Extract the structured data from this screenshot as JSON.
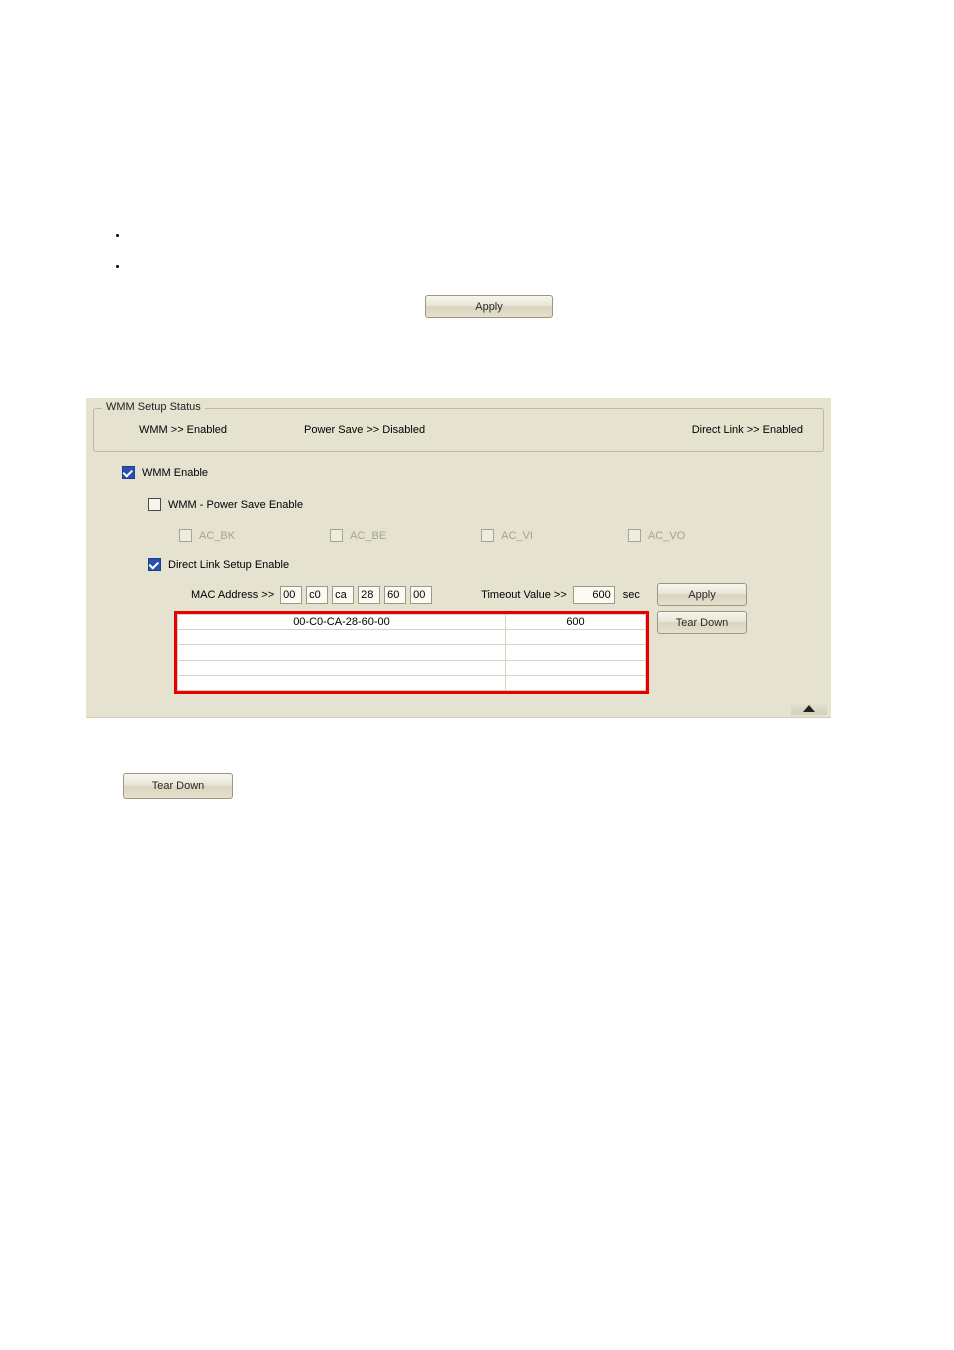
{
  "buttons": {
    "apply_top": "Apply",
    "apply_inline": "Apply",
    "teardown_inline": "Tear Down",
    "teardown_lower": "Tear Down"
  },
  "fieldset": {
    "legend": "WMM Setup Status",
    "wmm_status": "WMM >> Enabled",
    "ps_status": "Power Save >> Disabled",
    "dls_status": "Direct Link >> Enabled"
  },
  "checks": {
    "wmm_enable": "WMM Enable",
    "ps_enable": "WMM - Power Save Enable",
    "ac_bk": "AC_BK",
    "ac_be": "AC_BE",
    "ac_vi": "AC_VI",
    "ac_vo": "AC_VO",
    "dls_enable": "Direct Link Setup Enable"
  },
  "mac": {
    "label": "MAC Address >>",
    "v0": "00",
    "v1": "c0",
    "v2": "ca",
    "v3": "28",
    "v4": "60",
    "v5": "00",
    "timeout_label": "Timeout Value >>",
    "timeout_value": "600",
    "sec": "sec"
  },
  "table": {
    "mac": "00-C0-CA-28-60-00",
    "timeout": "600"
  }
}
